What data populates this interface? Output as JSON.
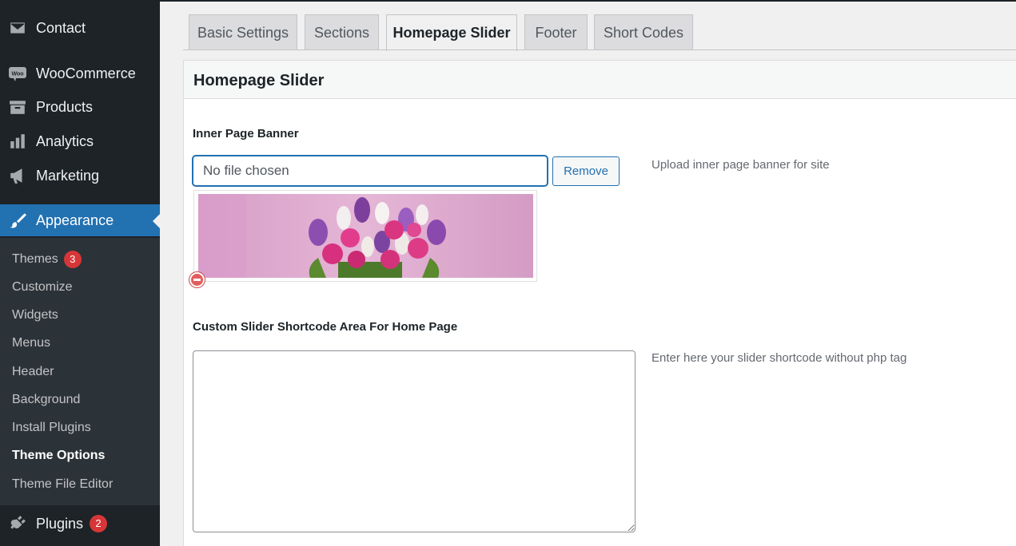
{
  "sidebar": {
    "menu": [
      {
        "label": "Contact",
        "icon": "mail-icon"
      },
      {
        "label": "WooCommerce",
        "icon": "woocommerce-icon"
      },
      {
        "label": "Products",
        "icon": "archive-icon"
      },
      {
        "label": "Analytics",
        "icon": "chart-bar-icon"
      },
      {
        "label": "Marketing",
        "icon": "megaphone-icon"
      },
      {
        "label": "Appearance",
        "icon": "paintbrush-icon"
      }
    ],
    "submenu": [
      {
        "label": "Themes",
        "badge": "3"
      },
      {
        "label": "Customize"
      },
      {
        "label": "Widgets"
      },
      {
        "label": "Menus"
      },
      {
        "label": "Header"
      },
      {
        "label": "Background"
      },
      {
        "label": "Install Plugins"
      },
      {
        "label": "Theme Options"
      },
      {
        "label": "Theme File Editor"
      }
    ],
    "plugins": {
      "label": "Plugins",
      "badge": "2",
      "icon": "plugin-icon"
    }
  },
  "tabs": [
    {
      "label": "Basic Settings"
    },
    {
      "label": "Sections"
    },
    {
      "label": "Homepage Slider"
    },
    {
      "label": "Footer"
    },
    {
      "label": "Short Codes"
    }
  ],
  "panel": {
    "title": "Homepage Slider",
    "banner": {
      "label": "Inner Page Banner",
      "file_value": "No file chosen",
      "remove_label": "Remove",
      "description": "Upload inner page banner for site"
    },
    "shortcode": {
      "label": "Custom Slider Shortcode Area For Home Page",
      "value": "",
      "description": "Enter here your slider shortcode without php tag"
    }
  },
  "colors": {
    "sidebar_bg": "#1d2327",
    "submenu_bg": "#2c3338",
    "accent": "#2271b1",
    "badge": "#d63638"
  }
}
